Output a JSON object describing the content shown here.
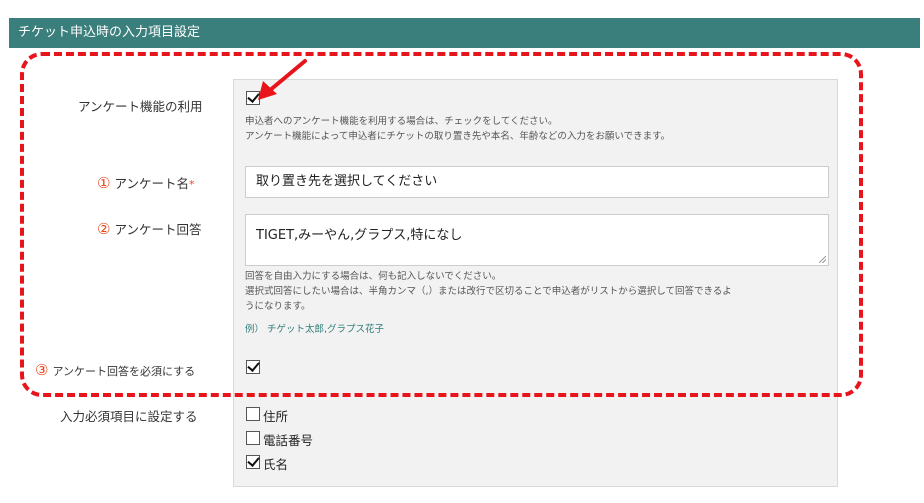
{
  "header": {
    "title": "チケット申込時の入力項目設定"
  },
  "survey_enable": {
    "label": "アンケート機能の利用",
    "checked": true,
    "help_line1": "申込者へのアンケート機能を利用する場合は、チェックをしてください。",
    "help_line2": "アンケート機能によって申込者にチケットの取り置き先や本名、年齢などの入力をお願いできます。"
  },
  "survey_name": {
    "number": "①",
    "label": "アンケート名",
    "required_mark": "*",
    "value": "取り置き先を選択してください"
  },
  "survey_answer": {
    "number": "②",
    "label": "アンケート回答",
    "value": "TIGET,みーやん,グラプス,特になし",
    "help_line1": "回答を自由入力にする場合は、何も記入しないでください。",
    "help_line2": "選択式回答にしたい場合は、半角カンマ（,）または改行で区切ることで申込者がリストから選択して回答できるよ",
    "help_line3": "うになります。",
    "example": "例） チゲット太郎,グラプス花子"
  },
  "survey_required": {
    "number": "③",
    "label": "アンケート回答を必須にする",
    "checked": true
  },
  "required_fields": {
    "label": "入力必須項目に設定する",
    "options": [
      {
        "label": "住所",
        "checked": false
      },
      {
        "label": "電話番号",
        "checked": false
      },
      {
        "label": "氏名",
        "checked": true
      }
    ]
  },
  "colors": {
    "header_bg": "#3a7f7c",
    "accent": "#e8481c",
    "annotation": "#e8141b"
  }
}
